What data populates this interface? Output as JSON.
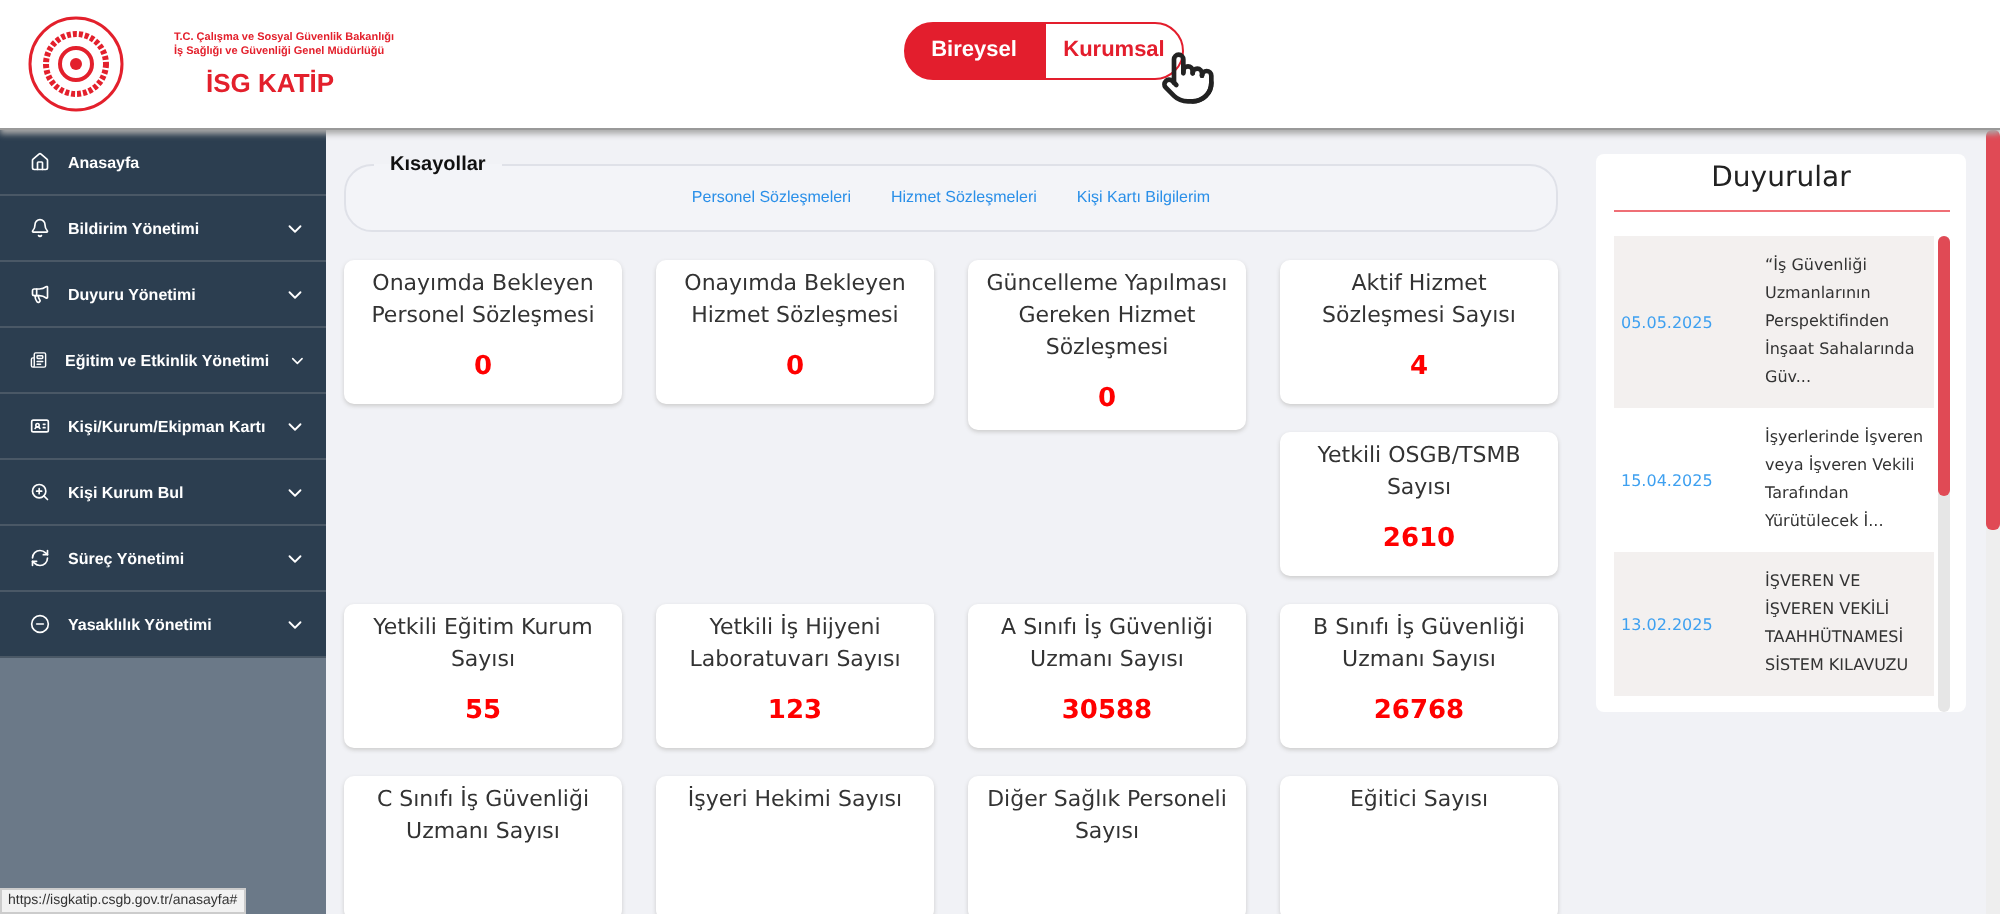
{
  "header": {
    "ministry_line_1": "T.C. Çalışma ve Sosyal Güvenlik Bakanlığı",
    "ministry_line_2": "İş Sağlığı ve Güvenliği Genel Müdürlüğü",
    "brand": "İSG KATİP",
    "toggle": [
      {
        "label": "Bireysel",
        "selected": true
      },
      {
        "label": "Kurumsal",
        "selected": false
      }
    ]
  },
  "sidebar": {
    "items": [
      {
        "label": "Anasayfa",
        "has_submenu": false
      },
      {
        "label": "Bildirim Yönetimi",
        "has_submenu": true
      },
      {
        "label": "Duyuru Yönetimi",
        "has_submenu": true
      },
      {
        "label": "Eğitim ve Etkinlik Yönetimi",
        "has_submenu": true
      },
      {
        "label": "Kişi/Kurum/Ekipman Kartı",
        "has_submenu": true
      },
      {
        "label": "Kişi Kurum Bul",
        "has_submenu": true
      },
      {
        "label": "Süreç Yönetimi",
        "has_submenu": true
      },
      {
        "label": "Yasaklılık Yönetimi",
        "has_submenu": true
      }
    ]
  },
  "shortcuts": {
    "title": "Kısayollar",
    "links": [
      "Personel Sözleşmeleri",
      "Hizmet Sözleşmeleri",
      "Kişi Kartı Bilgilerim"
    ]
  },
  "top_columns": [
    [
      {
        "label": "Onayımda Bekleyen Personel Sözleşmesi",
        "value": "0"
      }
    ],
    [
      {
        "label": "Onayımda Bekleyen Hizmet Sözleşmesi",
        "value": "0"
      }
    ],
    [
      {
        "label": "Güncelleme Yapılması Gereken Hizmet Sözleşmesi",
        "value": "0"
      }
    ],
    [
      {
        "label": "Aktif Hizmet Sözleşmesi Sayısı",
        "value": "4"
      },
      {
        "label": "Yetkili OSGB/TSMB Sayısı",
        "value": "2610"
      }
    ]
  ],
  "cards": [
    {
      "label": "Yetkili Eğitim Kurum Sayısı",
      "value": "55"
    },
    {
      "label": "Yetkili İş Hijyeni Laboratuvarı Sayısı",
      "value": "123"
    },
    {
      "label": "A Sınıfı İş Güvenliği Uzmanı Sayısı",
      "value": "30588"
    },
    {
      "label": "B Sınıfı İş Güvenliği Uzmanı Sayısı",
      "value": "26768"
    },
    {
      "label": "C Sınıfı İş Güvenliği Uzmanı Sayısı"
    },
    {
      "label": "İşyeri Hekimi Sayısı"
    },
    {
      "label": "Diğer Sağlık Personeli Sayısı"
    },
    {
      "label": "Eğitici Sayısı"
    }
  ],
  "announcements": {
    "title": "Duyurular",
    "items": [
      {
        "date": "05.05.2025",
        "text": "“İş Güvenliği Uzmanlarının Perspektifinden İnşaat Sahalarında Güv..."
      },
      {
        "date": "15.04.2025",
        "text": "İşyerlerinde İşveren veya İşveren Vekili Tarafından Yürütülecek İ..."
      },
      {
        "date": "13.02.2025",
        "text": "İŞVEREN VE İŞVEREN VEKİLİ TAAHHÜTNAMESİ SİSTEM KILAVUZU"
      }
    ]
  },
  "status_url": "https://isgkatip.csgb.gov.tr/anasayfa#"
}
